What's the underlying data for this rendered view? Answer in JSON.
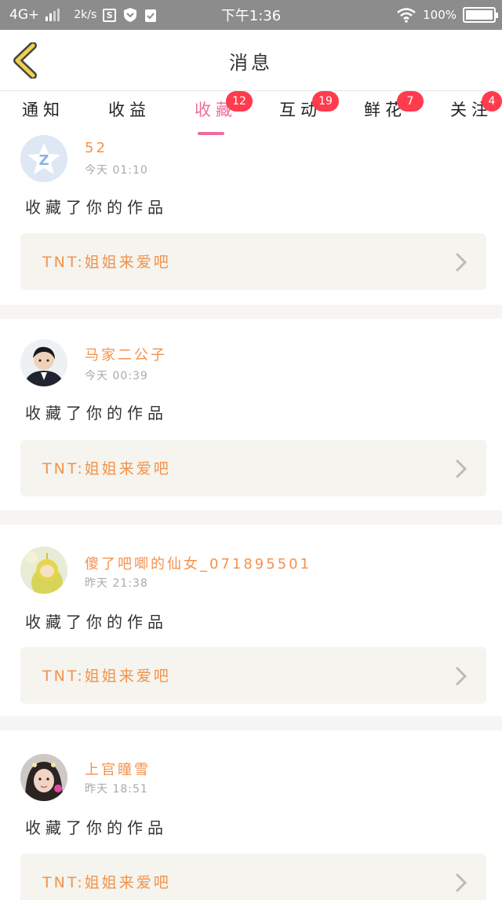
{
  "status_bar": {
    "network": "4G+",
    "speed": "2k/s",
    "time": "下午1:36",
    "battery": "100%"
  },
  "header": {
    "title": "消息"
  },
  "tabs": [
    {
      "label": "通知",
      "badge": ""
    },
    {
      "label": "收益",
      "badge": ""
    },
    {
      "label": "收藏",
      "badge": "12",
      "active": true
    },
    {
      "label": "互动",
      "badge": "19"
    },
    {
      "label": "鲜花",
      "badge": "7"
    },
    {
      "label": "关注",
      "badge": "4"
    }
  ],
  "messages": [
    {
      "username": "52",
      "time": "今天 01:10",
      "action": "收藏了你的作品",
      "work_title": "TNT:姐姐来爱吧",
      "avatar": "qq-logo-avatar"
    },
    {
      "username": "马家二公子",
      "time": "今天 00:39",
      "action": "收藏了你的作品",
      "work_title": "TNT:姐姐来爱吧",
      "avatar": "boy-photo-avatar"
    },
    {
      "username": "傻了吧唧的仙女_071895501",
      "time": "昨天 21:38",
      "action": "收藏了你的作品",
      "work_title": "TNT:姐姐来爱吧",
      "avatar": "teletubby-avatar"
    },
    {
      "username": "上官瞳雪",
      "time": "昨天 18:51",
      "action": "收藏了你的作品",
      "work_title": "TNT:姐姐来爱吧",
      "avatar": "girl-photo-avatar"
    }
  ],
  "colors": {
    "accent_pink": "#f06c9e",
    "username_orange": "#f3924c",
    "badge_red": "#ff3b4e",
    "back_yellow": "#f2d04a"
  }
}
